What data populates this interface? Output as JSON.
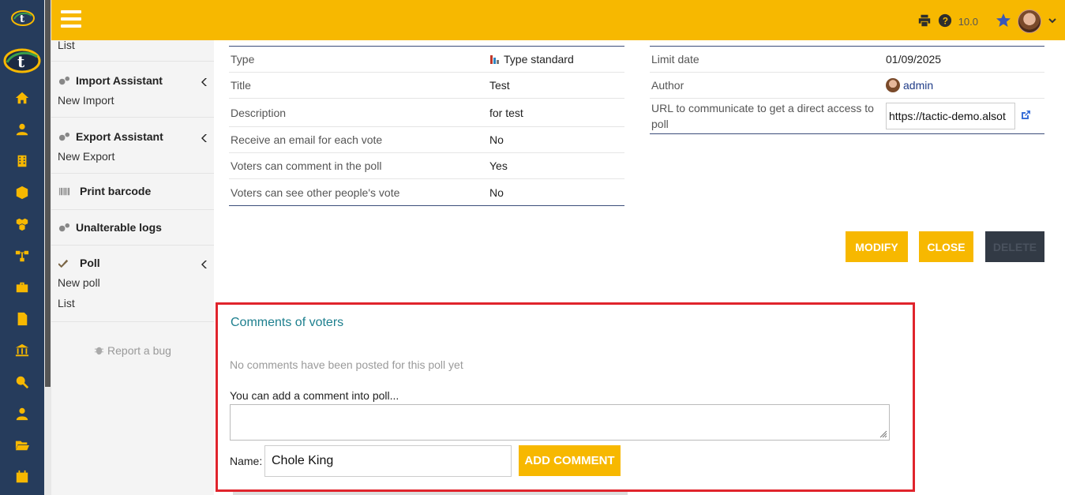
{
  "topbar": {
    "version": "10.0"
  },
  "sidebar": {
    "top_item": "List",
    "sections": [
      {
        "title": "Import Assistant",
        "items": [
          "New Import"
        ]
      },
      {
        "title": "Export Assistant",
        "items": [
          "New Export"
        ]
      },
      {
        "title": "Print barcode",
        "items": []
      },
      {
        "title": "Unalterable logs",
        "items": []
      },
      {
        "title": "Poll",
        "items": [
          "New poll",
          "List"
        ]
      }
    ],
    "report_bug": "Report a bug"
  },
  "details_left": [
    {
      "key": "Type",
      "value": "Type standard"
    },
    {
      "key": "Title",
      "value": "Test"
    },
    {
      "key": "Description",
      "value": "for test"
    },
    {
      "key": "Receive an email for each vote",
      "value": "No"
    },
    {
      "key": "Voters can comment in the poll",
      "value": "Yes"
    },
    {
      "key": "Voters can see other people's vote",
      "value": "No"
    }
  ],
  "details_right": {
    "limit_date_label": "Limit date",
    "limit_date": "01/09/2025",
    "author_label": "Author",
    "author": "admin",
    "url_label": "URL to communicate to get a direct access to poll",
    "url": "https://tactic-demo.alsot"
  },
  "actions": {
    "modify": "MODIFY",
    "close": "CLOSE",
    "delete": "DELETE"
  },
  "comments": {
    "title": "Comments of voters",
    "empty": "No comments have been posted for this poll yet",
    "hint": "You can add a comment into poll...",
    "name_label": "Name:",
    "name_value": "Chole King",
    "add_button": "ADD COMMENT"
  },
  "colors": {
    "accent": "#f7b800",
    "rail": "#263c5c",
    "highlight": "#e0242c"
  }
}
